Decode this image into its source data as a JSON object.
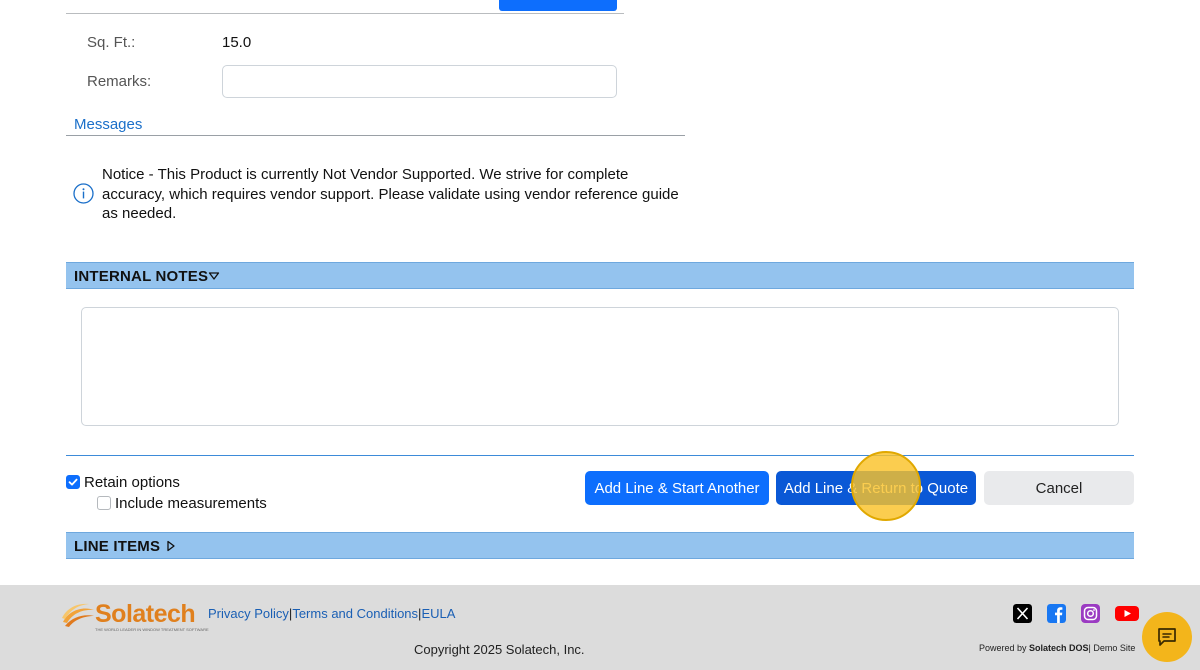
{
  "form": {
    "sqft_label": "Sq. Ft.:",
    "sqft_value": "15.0",
    "remarks_label": "Remarks:",
    "remarks_value": ""
  },
  "messages": {
    "title": "Messages",
    "notice": "Notice - This Product is currently Not Vendor Supported. We strive for complete accuracy, which requires vendor support. Please validate using vendor reference guide as needed.",
    "icon": "info-icon"
  },
  "internal_notes": {
    "title": "INTERNAL NOTES",
    "expanded": true,
    "value": ""
  },
  "options": {
    "retain_options_label": "Retain options",
    "retain_options_checked": true,
    "include_measurements_label": "Include measurements",
    "include_measurements_checked": false
  },
  "actions": {
    "add_start_another": "Add Line & Start Another",
    "add_return_quote": "Add Line & Return to Quote",
    "cancel": "Cancel"
  },
  "line_items": {
    "title": "LINE ITEMS",
    "expanded": false
  },
  "footer": {
    "brand": "Solatech",
    "tagline": "THE WORLD LEADER IN WINDOW TREATMENT SOFTWARE",
    "links": [
      "Privacy Policy",
      "Terms and Conditions",
      "EULA"
    ],
    "copyright": "Copyright 2025 Solatech, Inc.",
    "powered_prefix": "Powered by ",
    "powered_brand": "Solatech DOS",
    "powered_suffix": "| Demo Site",
    "social": [
      "x-icon",
      "facebook-icon",
      "instagram-icon",
      "youtube-icon"
    ]
  },
  "colors": {
    "primary": "#0d6efd",
    "section_bar": "#94c3ee",
    "highlight": "#f3b51b",
    "footer_bg": "#dcdcdc"
  }
}
